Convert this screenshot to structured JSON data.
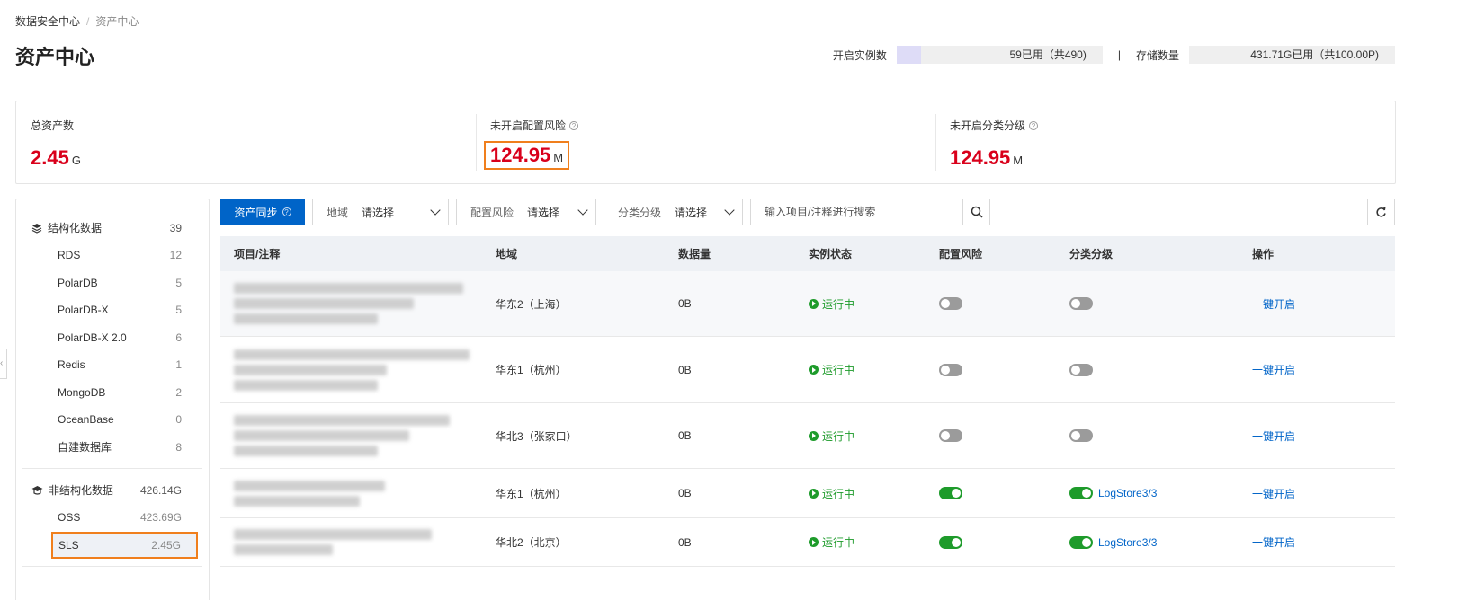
{
  "breadcrumb": {
    "root": "数据安全中心",
    "current": "资产中心"
  },
  "page_title": "资产中心",
  "quota": {
    "instances": {
      "label": "开启实例数",
      "text": "59已用（共490)",
      "used_fraction": 0.12
    },
    "storage": {
      "label": "存储数量",
      "text": "431.71G已用（共100.00P)",
      "used_fraction": 0.0
    },
    "separator": "|"
  },
  "stats": [
    {
      "label": "总资产数",
      "value": "2.45",
      "unit": "G",
      "help": false
    },
    {
      "label": "未开启配置风险",
      "value": "124.95",
      "unit": "M",
      "help": true
    },
    {
      "label": "未开启分类分级",
      "value": "124.95",
      "unit": "M",
      "help": true
    }
  ],
  "sidebar": {
    "structured": {
      "label": "结构化数据",
      "count": "39",
      "items": [
        {
          "label": "RDS",
          "count": "12"
        },
        {
          "label": "PolarDB",
          "count": "5"
        },
        {
          "label": "PolarDB-X",
          "count": "5"
        },
        {
          "label": "PolarDB-X 2.0",
          "count": "6"
        },
        {
          "label": "Redis",
          "count": "1"
        },
        {
          "label": "MongoDB",
          "count": "2"
        },
        {
          "label": "OceanBase",
          "count": "0"
        },
        {
          "label": "自建数据库",
          "count": "8"
        }
      ]
    },
    "unstructured": {
      "label": "非结构化数据",
      "count": "426.14G",
      "items": [
        {
          "label": "OSS",
          "count": "423.69G"
        },
        {
          "label": "SLS",
          "count": "2.45G"
        }
      ]
    }
  },
  "toolbar": {
    "sync_label": "资产同步",
    "region": {
      "label": "地域",
      "value": "请选择"
    },
    "risk": {
      "label": "配置风险",
      "value": "请选择"
    },
    "classification": {
      "label": "分类分级",
      "value": "请选择"
    },
    "search_placeholder": "输入项目/注释进行搜索"
  },
  "table": {
    "headers": [
      "项目/注释",
      "地域",
      "数据量",
      "实例状态",
      "配置风险",
      "分类分级",
      "操作"
    ],
    "rows": [
      {
        "region": "华东2（上海）",
        "size": "0B",
        "status": "运行中",
        "risk_on": false,
        "class_on": false,
        "class_text": "",
        "action": "一键开启"
      },
      {
        "region": "华东1（杭州）",
        "size": "0B",
        "status": "运行中",
        "risk_on": false,
        "class_on": false,
        "class_text": "",
        "action": "一键开启"
      },
      {
        "region": "华北3（张家口）",
        "size": "0B",
        "status": "运行中",
        "risk_on": false,
        "class_on": false,
        "class_text": "",
        "action": "一键开启"
      },
      {
        "region": "华东1（杭州）",
        "size": "0B",
        "status": "运行中",
        "risk_on": true,
        "class_on": true,
        "class_text": "LogStore3/3",
        "action": "一键开启"
      },
      {
        "region": "华北2（北京）",
        "size": "0B",
        "status": "运行中",
        "risk_on": true,
        "class_on": true,
        "class_text": "LogStore3/3",
        "action": "一键开启"
      }
    ]
  }
}
